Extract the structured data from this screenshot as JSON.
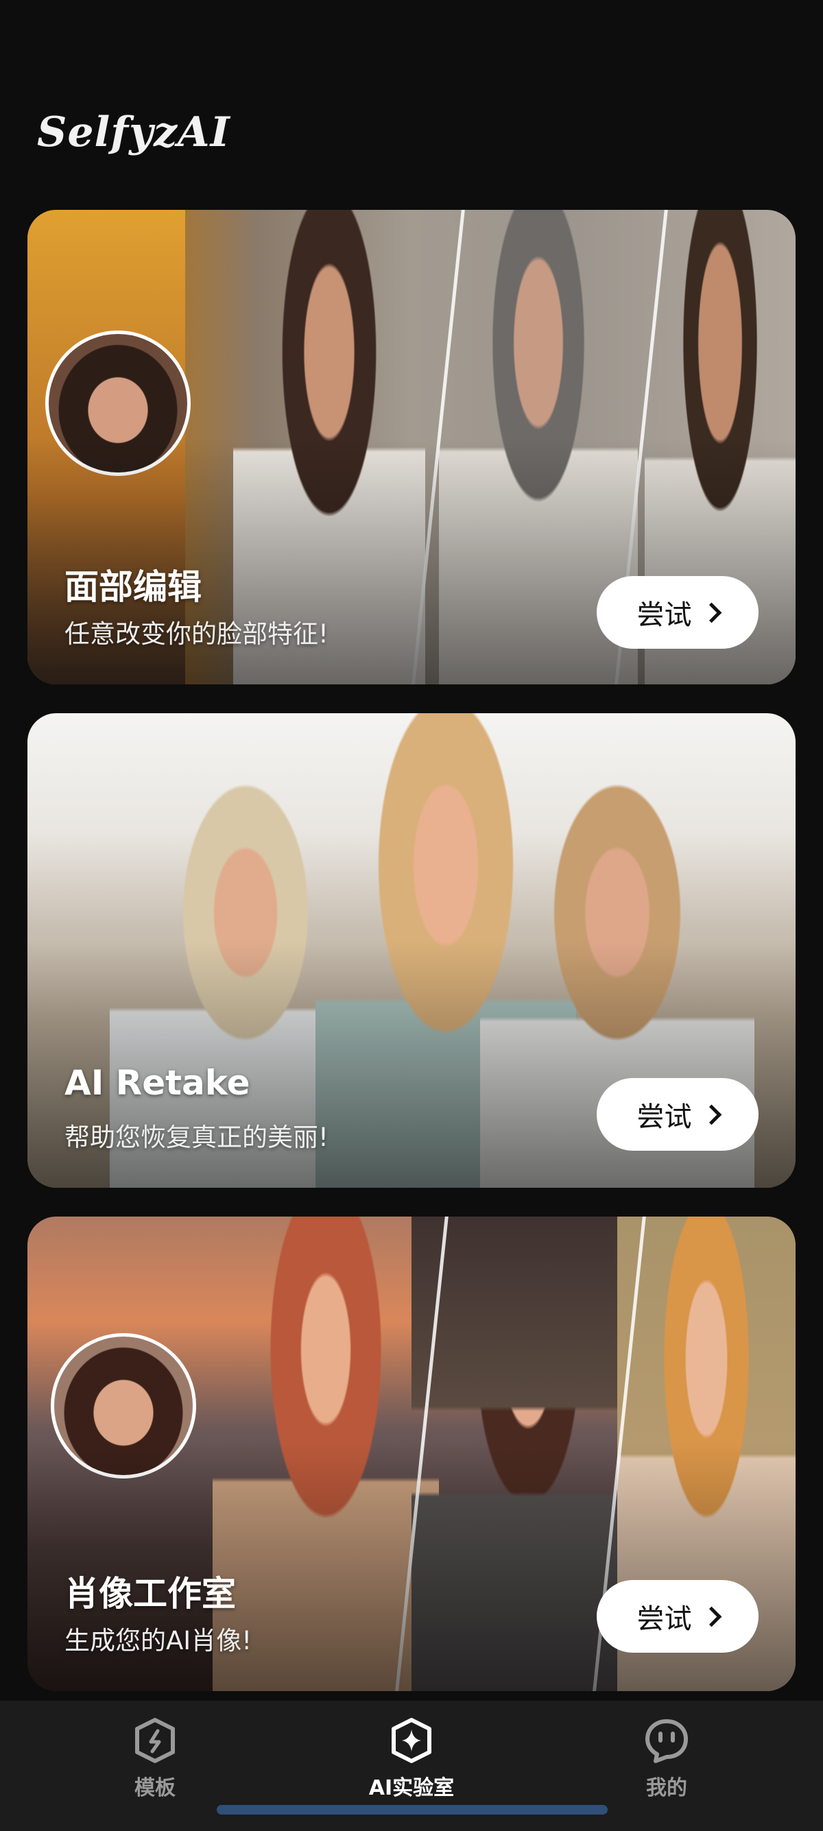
{
  "app": {
    "logo": "SelfyzAI"
  },
  "cards": [
    {
      "title": "面部编辑",
      "subtitle": "任意改变你的脸部特征!",
      "button": "尝试"
    },
    {
      "title": "AI Retake",
      "subtitle": "帮助您恢复真正的美丽!",
      "button": "尝试"
    },
    {
      "title": "肖像工作室",
      "subtitle": "生成您的AI肖像!",
      "button": "尝试"
    }
  ],
  "nav": {
    "items": [
      {
        "label": "模板",
        "icon": "template-icon",
        "active": false
      },
      {
        "label": "AI实验室",
        "icon": "ai-lab-icon",
        "active": true
      },
      {
        "label": "我的",
        "icon": "profile-icon",
        "active": false
      }
    ]
  },
  "colors": {
    "background": "#0d0d0d",
    "nav_background": "#1c1c1c",
    "button_background": "#ffffff",
    "home_indicator": "#2f4f78"
  }
}
